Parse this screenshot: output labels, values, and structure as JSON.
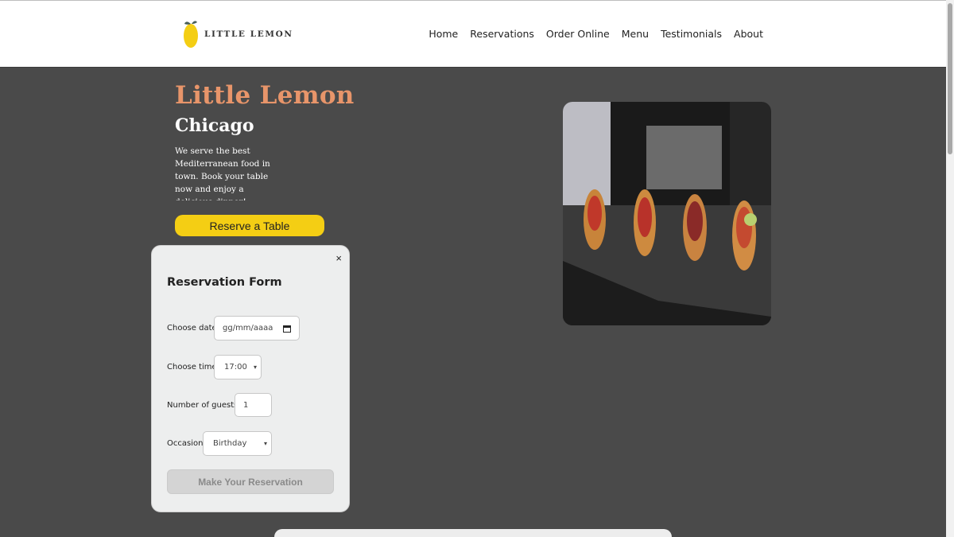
{
  "header": {
    "logo_text": "LITTLE LEMON",
    "nav": [
      "Home",
      "Reservations",
      "Order Online",
      "Menu",
      "Testimonials",
      "About"
    ]
  },
  "hero": {
    "title": "Little Lemon",
    "city": "Chicago",
    "description": "We serve the best Mediterranean food in town. Book your table now and enjoy a delicious dinner!",
    "reserve_label": "Reserve a Table"
  },
  "form": {
    "close_label": "×",
    "title": "Reservation Form",
    "date_label": "Choose date",
    "date_placeholder": "gg/mm/aaaa",
    "time_label": "Choose time",
    "time_value": "17:00",
    "guests_label": "Number of guests",
    "guests_value": "1",
    "occasion_label": "Occasion",
    "occasion_value": "Birthday",
    "submit_label": "Make Your Reservation"
  },
  "colors": {
    "brand_yellow": "#f4ce14",
    "title_orange": "#e8956a",
    "background": "#4a4a4a"
  }
}
